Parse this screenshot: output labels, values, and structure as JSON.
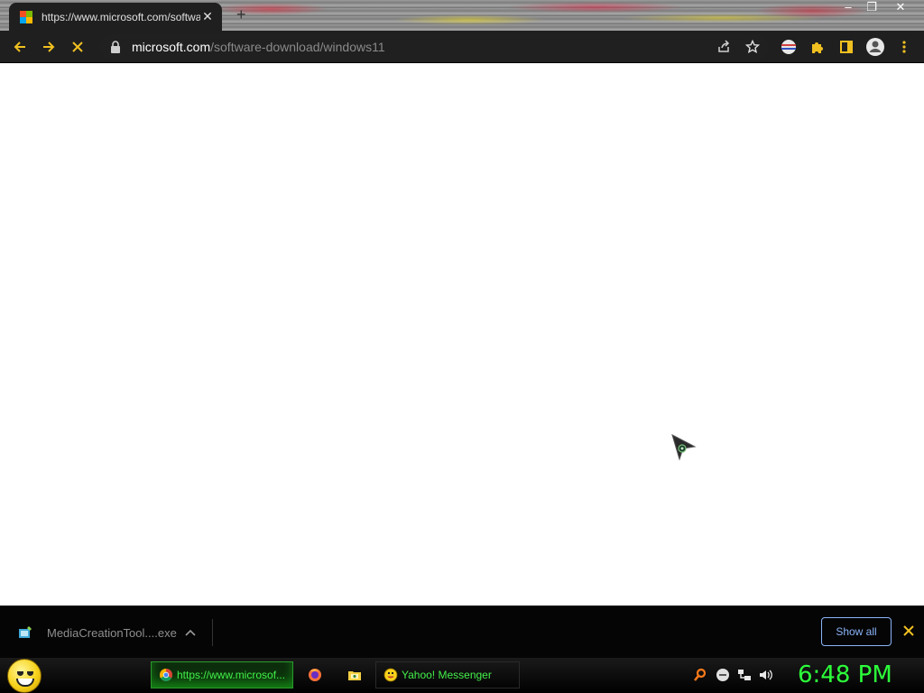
{
  "browser": {
    "tab": {
      "title": "https://www.microsoft.com/software-download/windows11",
      "close_icon": "close-icon"
    },
    "new_tab_label": "+",
    "window_controls": {
      "minimize": "–",
      "restore": "❐",
      "close": "✕"
    },
    "address_bar": {
      "host": "microsoft.com",
      "path": "/software-download/windows11"
    },
    "icons": {
      "back": "back-arrow-icon",
      "forward": "forward-arrow-icon",
      "stop": "stop-loading-icon",
      "lock": "lock-icon",
      "share": "share-icon",
      "bookmark": "star-icon",
      "extensions": "puzzle-icon",
      "profile": "profile-icon",
      "menu": "kebab-menu-icon"
    }
  },
  "downloads": {
    "file_name": "MediaCreationTool....exe",
    "show_all_label": "Show all"
  },
  "taskbar": {
    "tasks": [
      {
        "label": "https://www.microsof...",
        "icon": "chrome-icon"
      },
      {
        "label": "",
        "icon": "firefox-icon"
      },
      {
        "label": "",
        "icon": "folder-icon"
      },
      {
        "label": "Yahoo! Messenger",
        "icon": "yahoo-messenger-icon"
      }
    ],
    "clock": "6:48 PM"
  },
  "colors": {
    "toolbar_bg": "#1f1f1f",
    "accent_blue": "#8ab4f8",
    "taskbar_green": "#43f04a",
    "clock_green": "#2cff3a"
  }
}
